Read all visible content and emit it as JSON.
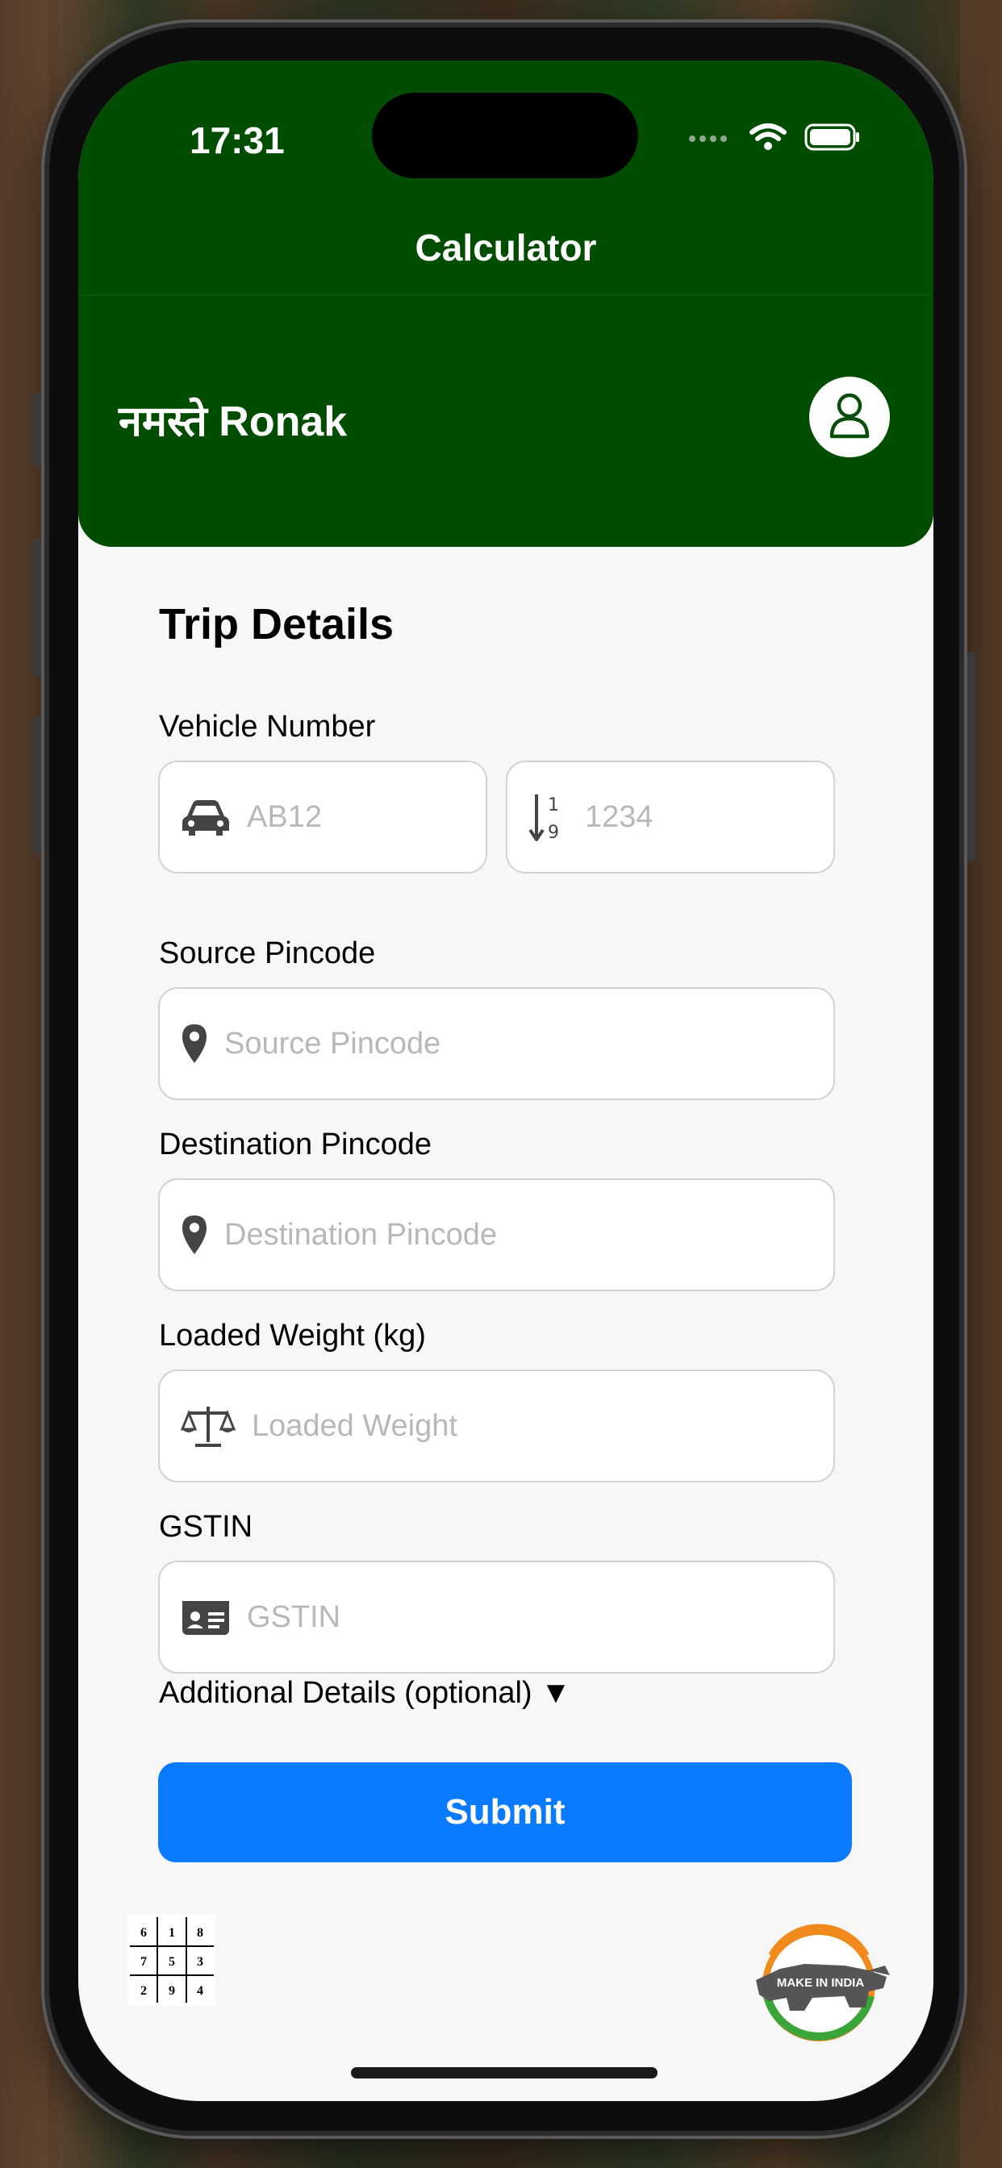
{
  "status_bar": {
    "time": "17:31"
  },
  "nav": {
    "title": "Calculator"
  },
  "header": {
    "greeting": "नमस्ते Ronak"
  },
  "form": {
    "section_title": "Trip Details",
    "vehicle_number": {
      "label": "Vehicle Number",
      "part1_placeholder": "AB12",
      "part2_placeholder": "1234"
    },
    "source_pincode": {
      "label": "Source Pincode",
      "placeholder": "Source Pincode"
    },
    "destination_pincode": {
      "label": "Destination Pincode",
      "placeholder": "Destination Pincode"
    },
    "loaded_weight": {
      "label": "Loaded Weight (kg)",
      "placeholder": "Loaded Weight"
    },
    "gstin": {
      "label": "GSTIN",
      "placeholder": "GSTIN"
    },
    "additional_details": "Additional Details (optional) ▼",
    "submit_label": "Submit"
  },
  "footer": {
    "grid_numbers": [
      "6",
      "1",
      "8",
      "7",
      "5",
      "3",
      "2",
      "9",
      "4"
    ],
    "make_in_india_text": "MAKE IN INDIA"
  },
  "colors": {
    "header_bg": "#004d00",
    "submit_bg": "#0a7aff",
    "screen_bg": "#f7f7f7"
  },
  "icons": [
    "wifi-icon",
    "battery-icon",
    "signal-icon",
    "profile-icon",
    "car-icon",
    "sort-number-icon",
    "location-pin-icon",
    "scale-icon",
    "id-card-icon"
  ]
}
